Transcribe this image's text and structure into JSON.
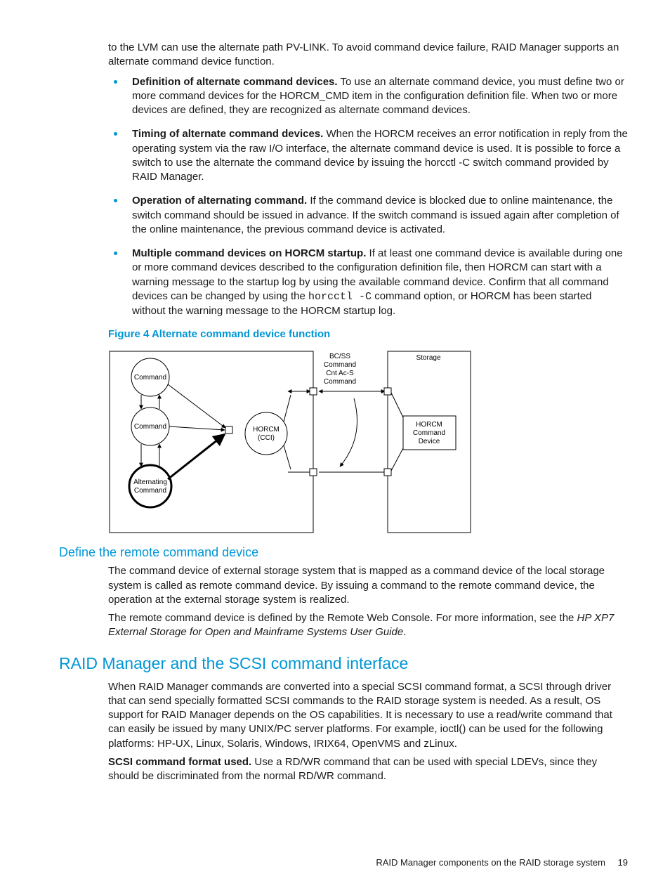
{
  "intro": "to the LVM can use the alternate path PV-LINK. To avoid command device failure, RAID Manager supports an alternate command device function.",
  "bullets": [
    {
      "title": "Definition of alternate command devices.",
      "body": " To use an alternate command device, you must define two or more command devices for the HORCM_CMD item in the configuration definition file. When two or more devices are defined, they are recognized as alternate command devices."
    },
    {
      "title": "Timing of alternate command devices.",
      "body": " When the HORCM receives an error notification in reply from the operating system via the raw I/O interface, the alternate command device is used. It is possible to force a switch to use the alternate the command device by issuing the horcctl -C switch command provided by RAID Manager."
    },
    {
      "title": "Operation of alternating command.",
      "body": " If the command device is blocked due to online maintenance, the switch command should be issued in advance. If the switch command is issued again after completion of the online maintenance, the previous command device is activated."
    },
    {
      "title": "Multiple command devices on HORCM startup.",
      "body_pre": " If at least one command device is available during one or more command devices described to the configuration definition file, then HORCM can start with a warning message to the startup log by using the available command device. Confirm that all command devices can be changed by using the ",
      "code": "horcctl -C",
      "body_post": " command option, or HORCM has been started without the warning message to the HORCM startup log."
    }
  ],
  "figure": {
    "caption": "Figure 4 Alternate command device function",
    "labels": {
      "command1": "Command",
      "command2": "Command",
      "alternating1": "Alternating",
      "alternating2": "Command",
      "horcm1": "HORCM",
      "horcm2": "(CCI)",
      "col_top1": "BC/SS",
      "col_top2": "Command",
      "col_top3": "Cnt Ac-S",
      "col_top4": "Command",
      "storage": "Storage",
      "dev1": "HORCM",
      "dev2": "Command",
      "dev3": "Device"
    }
  },
  "sub_heading": "Define the remote command device",
  "sub_para1": "The command device of external storage system that is mapped as a command device of the local storage system is called as remote command device. By issuing a command to the remote command device, the operation at the external storage system is realized.",
  "sub_para2_pre": "The remote command device is defined by the Remote Web Console. For more information, see the ",
  "sub_para2_italic": "HP XP7 External Storage for Open and Mainframe Systems User Guide",
  "sub_para2_post": ".",
  "section_heading": "RAID Manager and the SCSI command interface",
  "sec_para1": "When RAID Manager commands are converted into a special SCSI command format, a SCSI through driver that can send specially formatted SCSI commands to the RAID storage system is needed. As a result, OS support for RAID Manager depends on the OS capabilities. It is necessary to use a read/write command that can easily be issued by many UNIX/PC server platforms. For example, ioctl() can be used for the following platforms: HP-UX, Linux, Solaris, Windows, IRIX64, OpenVMS and zLinux.",
  "sec_para2_bold": "SCSI command format used.",
  "sec_para2_body": " Use a RD/WR command that can be used with special LDEVs, since they should be discriminated from the normal RD/WR command.",
  "footer": {
    "text": "RAID Manager components on the RAID storage system",
    "page": "19"
  }
}
